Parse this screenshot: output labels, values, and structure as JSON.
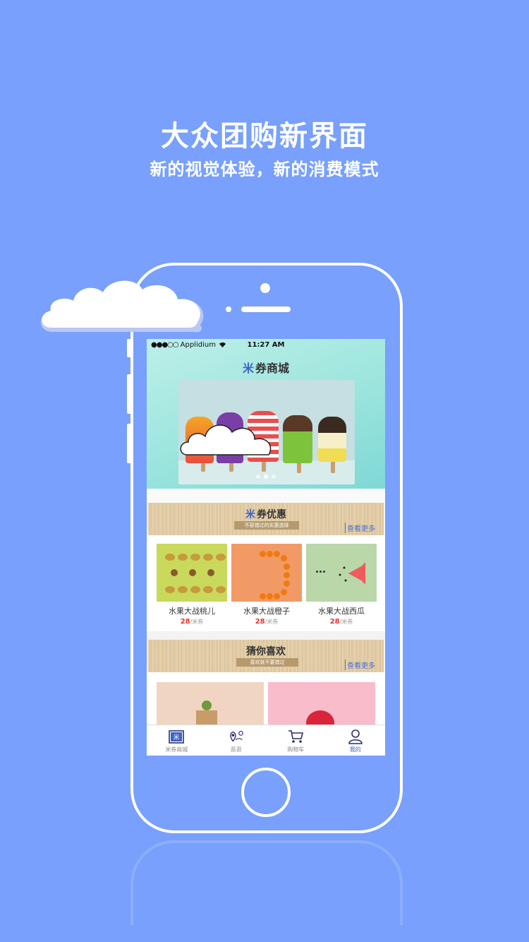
{
  "promo": {
    "headline": "大众团购新界面",
    "subline": "新的视觉体验，新的消费模式"
  },
  "status_bar": {
    "signal": "●●●○○",
    "carrier": "Applidium",
    "time": "11:27 AM"
  },
  "app": {
    "logo_glyph": "米",
    "title": "券商城"
  },
  "banner": {
    "indicator_count": 3,
    "active_index": 1
  },
  "deals": {
    "logo_glyph": "米",
    "title": "券优惠",
    "subtitle": "不容错过的实惠选择",
    "more": "查看更多",
    "items": [
      {
        "name": "水果大战桃儿",
        "price": "28",
        "unit": "/米券"
      },
      {
        "name": "水果大战橙子",
        "price": "28",
        "unit": "/米券"
      },
      {
        "name": "水果大战西瓜",
        "price": "28",
        "unit": "/米券"
      }
    ]
  },
  "guess": {
    "title": "猜你喜欢",
    "subtitle": "喜欢就不要错过",
    "more": "查看更多"
  },
  "tabbar": {
    "items": [
      {
        "label": "米券商城",
        "icon": "mi-coupon-icon"
      },
      {
        "label": "逛逛",
        "icon": "map-pin-icon"
      },
      {
        "label": "购物车",
        "icon": "cart-icon"
      },
      {
        "label": "我的",
        "icon": "user-icon"
      }
    ],
    "active_index": 3
  },
  "colors": {
    "background": "#78a0fc",
    "accent": "#3b63c8",
    "price": "#e8322d"
  }
}
